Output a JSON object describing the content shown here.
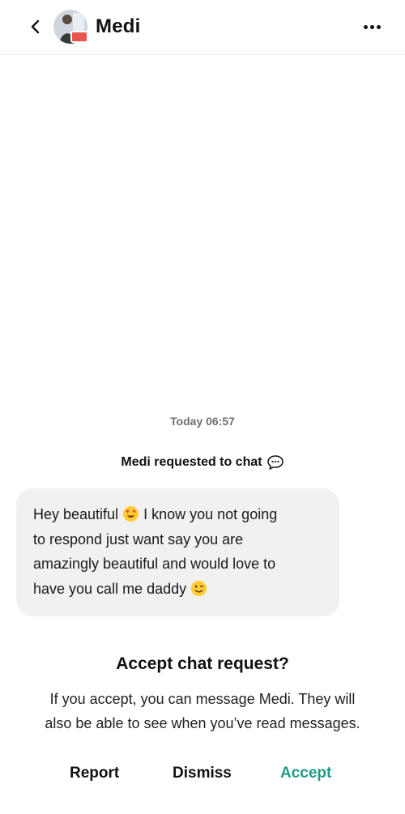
{
  "header": {
    "contact_name": "Medi"
  },
  "chat": {
    "timestamp": "Today 06:57",
    "request_notice": "Medi requested to chat",
    "message_lines": [
      "Hey beautiful",
      "I know you not going",
      "to respond just want say you are",
      "amazingly beautiful and would love to",
      "have you call me daddy"
    ]
  },
  "prompt": {
    "title": "Accept chat request?",
    "description_line1": "If you accept, you can message Medi. They will",
    "description_line2": "also be able to see when you’ve read messages."
  },
  "actions": {
    "report": "Report",
    "dismiss": "Dismiss",
    "accept": "Accept"
  },
  "colors": {
    "accept": "#1f9d84",
    "bubble": "#f2f1f2",
    "badge": "#e8564f"
  },
  "icons": {
    "back": "chevron-left-icon",
    "more": "more-horizontal-icon",
    "chat": "speech-bubble-icon",
    "emoji_1": "heart-eyes-emoji-icon",
    "emoji_2": "wink-emoji-icon"
  }
}
